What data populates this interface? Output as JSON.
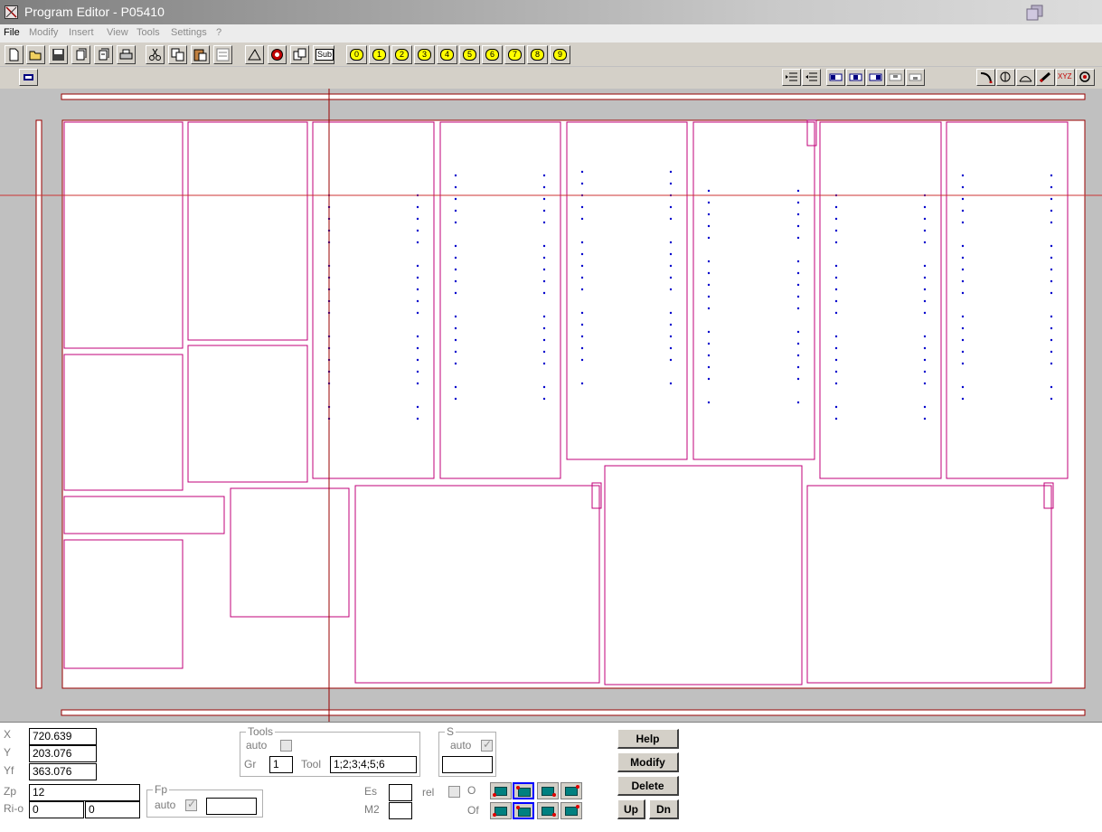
{
  "window": {
    "title": "Program Editor - P05410"
  },
  "menu": [
    "File",
    "Modify",
    "Insert",
    "View",
    "Tools",
    "Settings",
    "?"
  ],
  "toolbar": {
    "icons": [
      "new-icon",
      "open-icon",
      "save-icon",
      "copy-page-icon",
      "edit-page-icon",
      "print-icon",
      "cut-icon",
      "copy-icon",
      "paste-icon",
      "list-icon",
      "triangle-icon",
      "gear-icon",
      "windows-icon"
    ],
    "sub_label": "Sub",
    "numbers": [
      "0",
      "1",
      "2",
      "3",
      "4",
      "5",
      "6",
      "7",
      "8",
      "9"
    ]
  },
  "toolbar2": {
    "right_icons": [
      "indent-icon",
      "outdent-icon",
      "align-left-icon",
      "align-center-icon",
      "align-right-icon",
      "align-top-icon",
      "align-bottom-icon",
      "arc-icon",
      "tool-icon",
      "curve-icon",
      "pencil-icon",
      "target-icon"
    ],
    "xyz_label": "XYZ"
  },
  "colors": {
    "part": "#c0007a",
    "axis": "#990000",
    "hole": "#0000cc",
    "canvas": "#c0c0c0",
    "toolbar": "#d4d0c8"
  },
  "coords": {
    "x_label": "X",
    "x_value": "720.639",
    "y_label": "Y",
    "y_value": "203.076",
    "yf_label": "Yf",
    "yf_value": "363.076",
    "zp_label": "Zp",
    "zp_value": "12",
    "rio_label": "Ri-o",
    "rio_value1": "0",
    "rio_value2": "0"
  },
  "fp": {
    "title": "Fp",
    "auto_label": "auto",
    "value": ""
  },
  "tools": {
    "title": "Tools",
    "auto_label": "auto",
    "gr_label": "Gr",
    "gr_value": "1",
    "tool_label": "Tool",
    "tool_value": "1;2;3;4;5;6"
  },
  "s_group": {
    "title": "S",
    "auto_label": "auto",
    "value": ""
  },
  "misc": {
    "es_label": "Es",
    "es_value": "",
    "m2_label": "M2",
    "m2_value": "",
    "rel_label": "rel",
    "o_label": "O",
    "of_label": "Of"
  },
  "buttons": {
    "help": "Help",
    "modify": "Modify",
    "delete": "Delete",
    "up": "Up",
    "dn": "Dn"
  }
}
